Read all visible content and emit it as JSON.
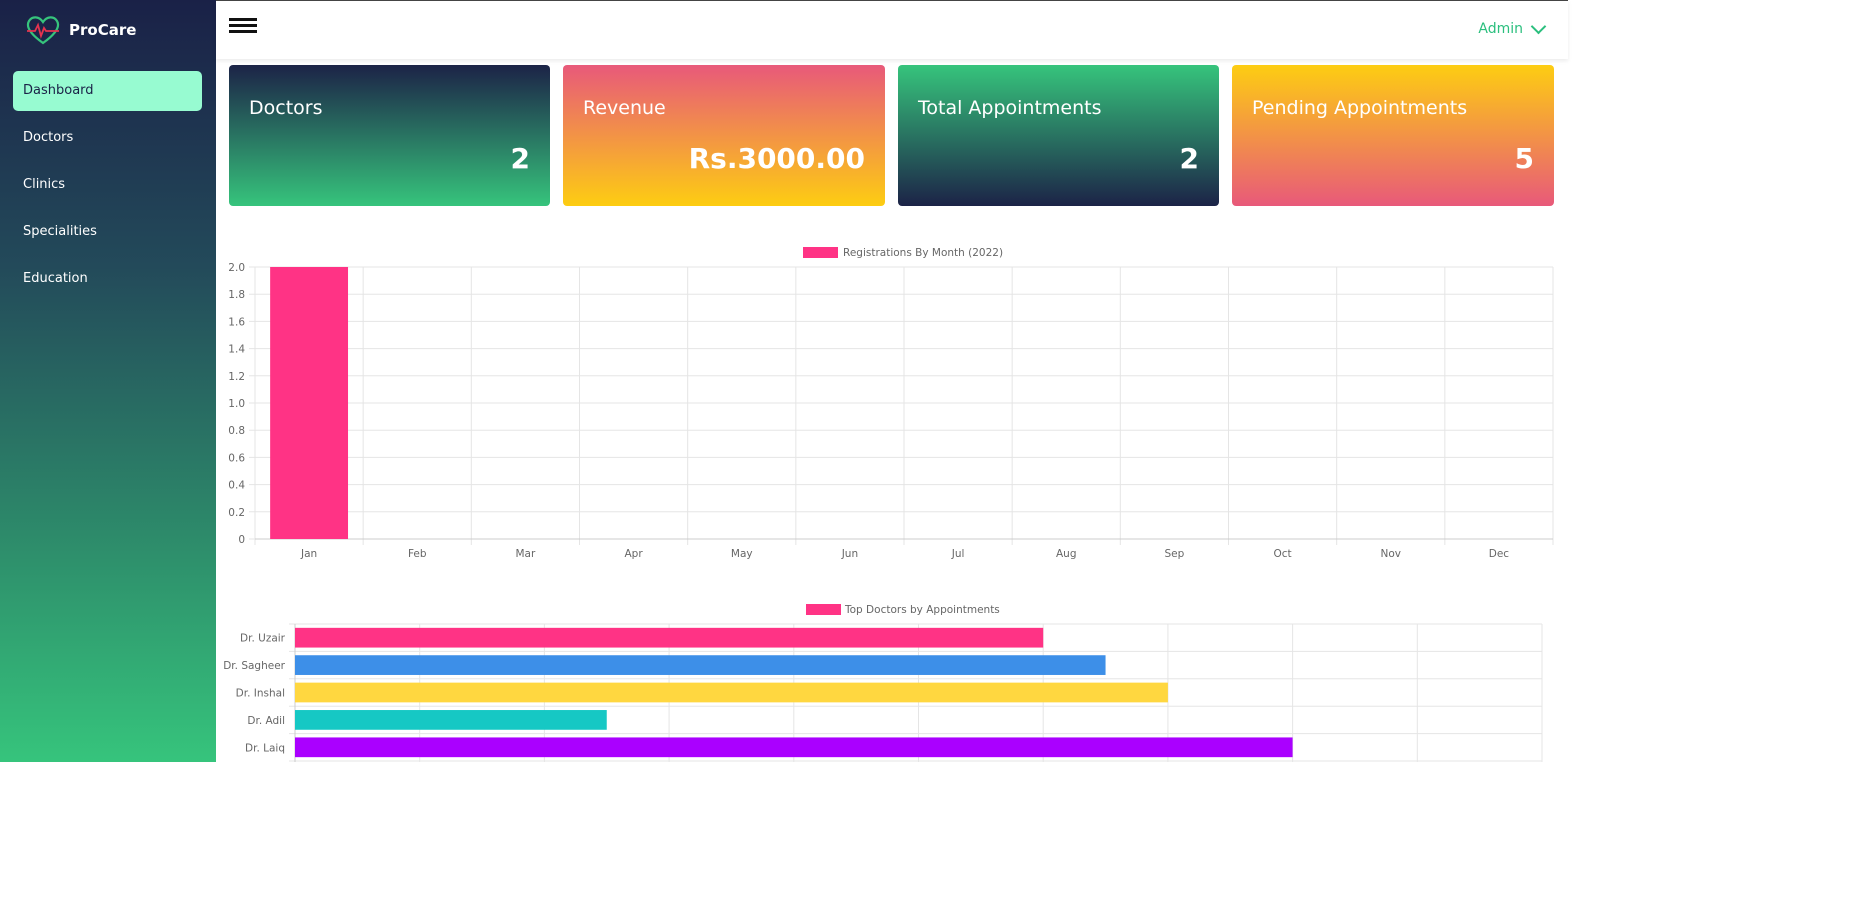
{
  "brand": {
    "name": "ProCare"
  },
  "sidebar": {
    "items": [
      {
        "label": "Dashboard",
        "active": true
      },
      {
        "label": "Doctors"
      },
      {
        "label": "Clinics"
      },
      {
        "label": "Specialities"
      },
      {
        "label": "Education"
      }
    ]
  },
  "topbar": {
    "user_label": "Admin"
  },
  "cards": [
    {
      "title": "Doctors",
      "value": "2"
    },
    {
      "title": "Revenue",
      "value": "Rs.3000.00"
    },
    {
      "title": "Total Appointments",
      "value": "2"
    },
    {
      "title": "Pending Appointments",
      "value": "5"
    }
  ],
  "colors": {
    "accent": "#2bbf7e",
    "active_nav": "#97fbd1",
    "bar_pink": "#ff3385",
    "grid": "#e5e5e5"
  },
  "chart_data": [
    {
      "type": "bar",
      "legend": "Registrations By Month (2022)",
      "categories": [
        "Jan",
        "Feb",
        "Mar",
        "Apr",
        "May",
        "Jun",
        "Jul",
        "Aug",
        "Sep",
        "Oct",
        "Nov",
        "Dec"
      ],
      "values": [
        2,
        0,
        0,
        0,
        0,
        0,
        0,
        0,
        0,
        0,
        0,
        0
      ],
      "ylim": [
        0,
        2.0
      ],
      "yticks": [
        "0",
        "0.2",
        "0.4",
        "0.6",
        "0.8",
        "1.0",
        "1.2",
        "1.4",
        "1.6",
        "1.8",
        "2.0"
      ],
      "color": "#ff3385",
      "grid": true,
      "legend_position": "top"
    },
    {
      "type": "bar",
      "orientation": "horizontal",
      "legend": "Top Doctors by Appointments",
      "categories": [
        "Dr. Uzair",
        "Dr. Sagheer",
        "Dr. Inshal",
        "Dr. Adil",
        "Dr. Laiq"
      ],
      "values": [
        6,
        6.5,
        7,
        2.5,
        8
      ],
      "xlim": [
        0,
        10
      ],
      "colors": [
        "#ff3385",
        "#3d8fe8",
        "#ffd740",
        "#16c8c4",
        "#aa00ff"
      ],
      "legend_color": "#ff3385",
      "grid": true,
      "legend_position": "top"
    }
  ]
}
